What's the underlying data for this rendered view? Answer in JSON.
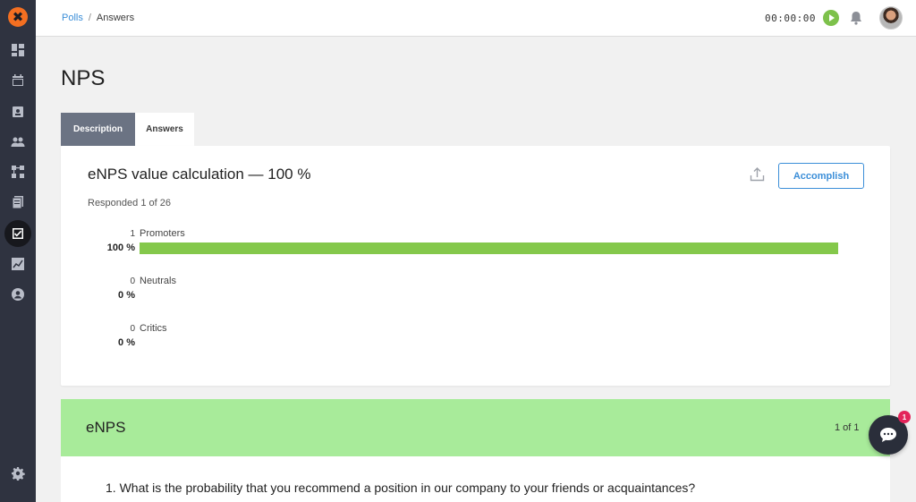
{
  "app": {
    "logo_glyph": "✖",
    "accent_color": "#f36f21"
  },
  "sidebar": {
    "items": [
      {
        "icon": "dashboard-icon"
      },
      {
        "icon": "calendar-icon"
      },
      {
        "icon": "contacts-card-icon"
      },
      {
        "icon": "people-icon"
      },
      {
        "icon": "org-structure-icon"
      },
      {
        "icon": "documents-icon"
      },
      {
        "icon": "polls-checkbox-icon",
        "active": true
      },
      {
        "icon": "analytics-icon"
      },
      {
        "icon": "user-circle-icon"
      }
    ],
    "settings_icon": "gear-icon"
  },
  "topbar": {
    "breadcrumb": [
      {
        "label": "Polls"
      },
      {
        "label": "Answers"
      }
    ],
    "separator": "/",
    "timer": "00:00:00"
  },
  "page": {
    "title": "NPS",
    "tabs": [
      {
        "label": "Description",
        "active": true
      },
      {
        "label": "Answers",
        "active": false
      }
    ]
  },
  "summary": {
    "title": "eNPS value calculation — 100 %",
    "action_label": "Accomplish",
    "responded": "Responded 1 of 26",
    "stats": [
      {
        "count": "1",
        "label": "Promoters",
        "percent": "100 %",
        "fraction": 1.0,
        "color": "#84c84b"
      },
      {
        "count": "0",
        "label": "Neutrals",
        "percent": "0 %",
        "fraction": 0.0,
        "color": "#84c84b"
      },
      {
        "count": "0",
        "label": "Critics",
        "percent": "0 %",
        "fraction": 0.0,
        "color": "#84c84b"
      }
    ]
  },
  "section": {
    "title": "eNPS",
    "page_count": "1 of 1",
    "color": "#a8eb9a",
    "question": "1. What is the probability that you recommend a position in our company to your friends or acquaintances?"
  },
  "chat": {
    "badge": "1"
  }
}
